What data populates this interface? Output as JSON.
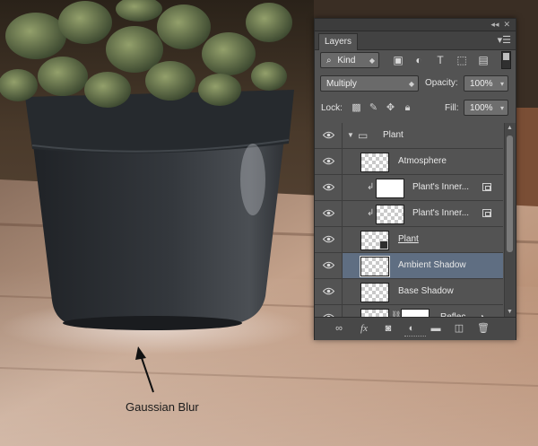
{
  "panel": {
    "tab_label": "Layers",
    "filter_kind": "Kind",
    "blend_mode": "Multiply",
    "opacity_label": "Opacity:",
    "opacity_value": "100%",
    "lock_label": "Lock:",
    "fill_label": "Fill:",
    "fill_value": "100%",
    "layers": [
      {
        "name": "Plant",
        "type": "group"
      },
      {
        "name": "Atmosphere",
        "type": "layer"
      },
      {
        "name": "Plant's Inner...",
        "type": "clipped-smart"
      },
      {
        "name": "Plant's Inner...",
        "type": "clipped-smart"
      },
      {
        "name": "Plant",
        "type": "smart"
      },
      {
        "name": "Ambient Shadow",
        "type": "layer",
        "selected": true
      },
      {
        "name": "Base Shadow",
        "type": "layer"
      },
      {
        "name": "Reflec...",
        "type": "masked"
      }
    ]
  },
  "annotation": {
    "caption": "Gaussian Blur"
  },
  "colors": {
    "panel_bg": "#535353",
    "selected_row": "#5f6e82",
    "pot": "#2c2f33"
  }
}
